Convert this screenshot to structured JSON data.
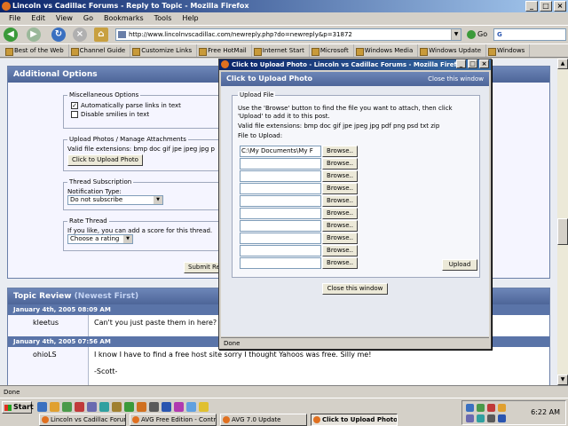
{
  "window": {
    "title": "Lincoln vs Cadillac Forums - Reply to Topic - Mozilla Firefox",
    "controls": [
      "_",
      "□",
      "×"
    ]
  },
  "menu": [
    "File",
    "Edit",
    "View",
    "Go",
    "Bookmarks",
    "Tools",
    "Help"
  ],
  "toolbar": {
    "url": "http://www.lincolnvscadillac.com/newreply.php?do=newreply&p=31872",
    "go_label": "Go",
    "search_value": "G"
  },
  "bookmarks": [
    "Best of the Web",
    "Channel Guide",
    "Customize Links",
    "Free HotMail",
    "Internet Start",
    "Microsoft",
    "Windows Media",
    "Windows Update",
    "Windows"
  ],
  "additional_options": {
    "heading": "Additional Options",
    "misc_legend": "Miscellaneous Options",
    "parse_links": "Automatically parse links in text",
    "disable_smilies": "Disable smilies in text",
    "upload_legend": "Upload Photos / Manage Attachments",
    "valid_ext": "Valid file extensions: bmp doc gif jpe jpeg jpg p",
    "upload_button": "Click to Upload Photo",
    "thread_legend": "Thread Subscription",
    "notification_label": "Notification Type:",
    "notification_value": "Do not subscribe",
    "rate_legend": "Rate Thread",
    "rate_text": "If you like, you can add a score for this thread.",
    "rate_value": "Choose a rating",
    "submit_label": "Submit Re"
  },
  "topic_review": {
    "heading": "Topic Review",
    "subheading": "(Newest First)",
    "posts": [
      {
        "date": "January 4th, 2005 08:09 AM",
        "author": "kleetus",
        "text": "Can't you just paste them in here?"
      },
      {
        "date": "January 4th, 2005 07:56 AM",
        "author": "ohioLS",
        "text": "I know I have to find a free host site sorry I thought Yahoos was free. Silly me!",
        "signature": "-Scott-"
      }
    ]
  },
  "popup": {
    "title": "Click to Upload Photo - Lincoln vs Cadillac Forums - Mozilla Firefox",
    "heading": "Click to Upload Photo",
    "close_link": "Close this window",
    "fieldset_legend": "Upload File",
    "instructions": "Use the 'Browse' button to find the file you want to attach, then click 'Upload' to add it to this post.",
    "valid_ext": "Valid file extensions: bmp doc gif jpe jpeg jpg pdf png psd txt zip",
    "file_label": "File to Upload:",
    "file_values": [
      "C:\\My Documents\\My F",
      "",
      "",
      "",
      "",
      "",
      "",
      "",
      "",
      ""
    ],
    "browse_label": "Browse..",
    "upload_label": "Upload",
    "close_button": "Close this window",
    "status": "Done"
  },
  "status": "Done",
  "taskbar": {
    "start": "Start",
    "tasks": [
      "Lincoln vs Cadillac Forums...",
      "AVG Free Edition - Contro...",
      "AVG 7.0 Update",
      "Click to Upload Photo -..."
    ],
    "active_task_index": 3,
    "clock": "6:22 AM"
  }
}
